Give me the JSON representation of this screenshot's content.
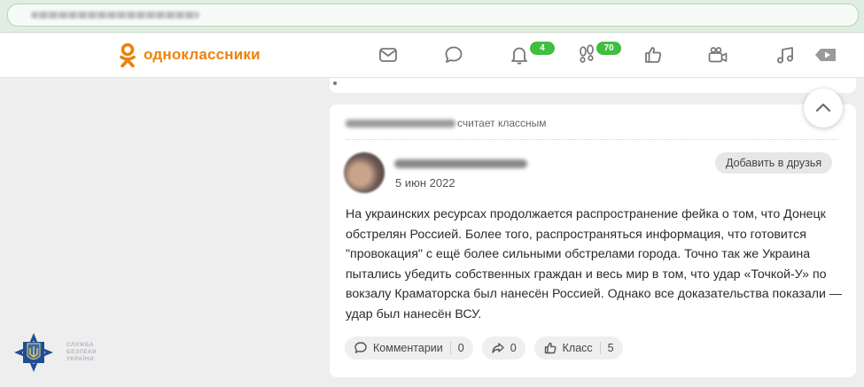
{
  "browser": {
    "address_blurred": true
  },
  "header": {
    "logo_text": "одноклассники",
    "brand_color": "#ee8208",
    "nav": [
      {
        "name": "messages-icon"
      },
      {
        "name": "discussions-icon"
      },
      {
        "name": "notifications-icon",
        "badge": "4"
      },
      {
        "name": "guests-icon",
        "badge": "70"
      },
      {
        "name": "events-icon"
      },
      {
        "name": "video-icon"
      },
      {
        "name": "music-icon"
      },
      {
        "name": "play-icon"
      }
    ],
    "badge_color": "#3fbe3f"
  },
  "post": {
    "activity_suffix": "считает классным",
    "date": "5 июн 2022",
    "add_friend_label": "Добавить в друзья",
    "text": "На украинских ресурсах продолжается распространение фейка о том, что Донецк обстрелян Россией. Более того, распространяться информация, что готовится \"провокация\" с ещё более сильными обстрелами города. Точно так же Украина пытались убедить собственных граждан и весь мир в том, что удар «Точкой-У» по вокзалу Краматорска был нанесён Россией. Однако все доказательства показали — удар был нанесён ВСУ.",
    "actions": {
      "comments_label": "Комментарии",
      "comments_count": "0",
      "share_count": "0",
      "like_label": "Класс",
      "like_count": "5"
    }
  },
  "watermark": {
    "line1": "СЛУЖБА",
    "line2": "БЕЗПЕКИ",
    "line3": "УКРАЇНИ"
  }
}
